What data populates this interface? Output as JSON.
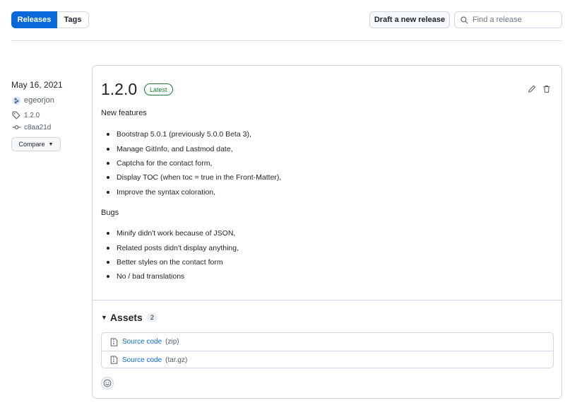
{
  "toolbar": {
    "tabs": [
      {
        "label": "Releases",
        "active": true
      },
      {
        "label": "Tags",
        "active": false
      }
    ],
    "draft_label": "Draft a new release",
    "search_placeholder": "Find a release",
    "search_icon": "search-icon"
  },
  "meta": {
    "date": "May 16, 2021",
    "author": "egeorjon",
    "tag": "1.2.0",
    "commit": "c8aa21d",
    "compare_label": "Compare"
  },
  "release": {
    "title": "1.2.0",
    "badge": "Latest",
    "sections": [
      {
        "heading": "New features",
        "items": [
          "Bootstrap 5.0.1 (previously 5.0.0 Beta 3),",
          "Manage GitInfo, and Lastmod date,",
          "Captcha for the contact form,",
          "Display TOC (when toc = true in the Front-Matter),",
          "Improve the syntax coloration,"
        ]
      },
      {
        "heading": "Bugs",
        "items": [
          "Minify didn't work because of JSON,",
          "Related posts didn't display anything,",
          "Better styles on the contact form",
          "No / bad translations"
        ]
      }
    ],
    "assets": {
      "label": "Assets",
      "count": "2",
      "items": [
        {
          "name": "Source code",
          "ext": "(zip)"
        },
        {
          "name": "Source code",
          "ext": "(tar.gz)"
        }
      ]
    }
  },
  "colors": {
    "accent": "#0969da",
    "latest_green": "#1a7f37",
    "border": "#d0d7de"
  }
}
